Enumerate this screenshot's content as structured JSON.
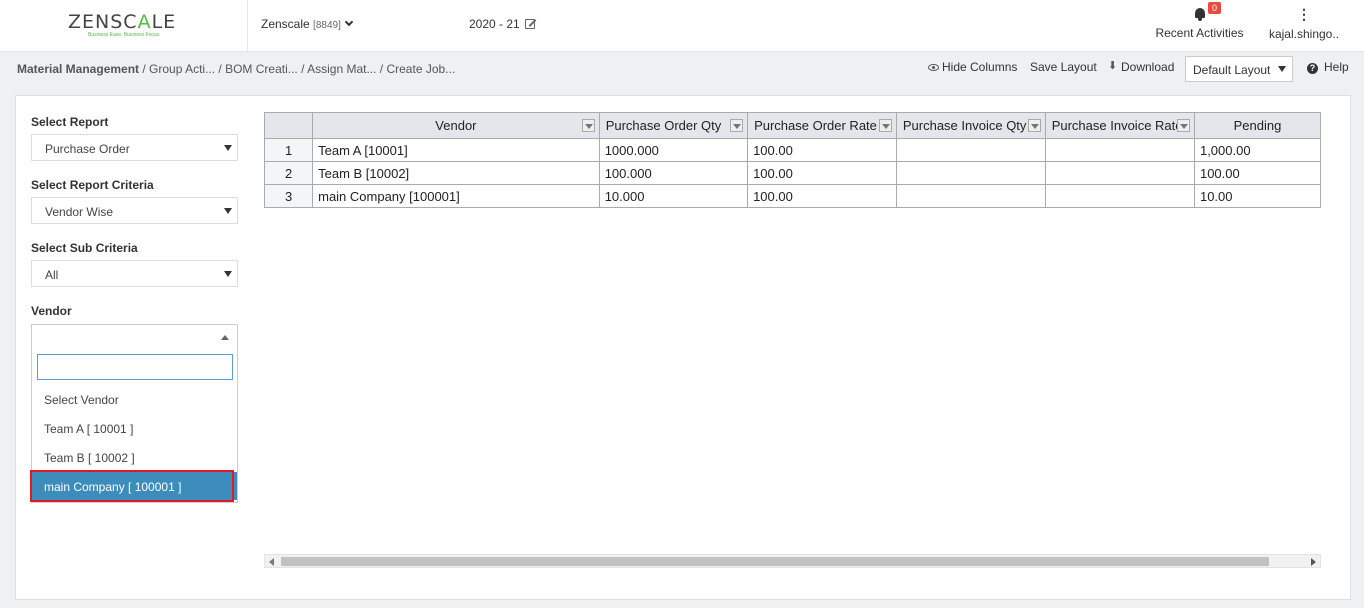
{
  "header": {
    "logo_main": "ZENSC",
    "logo_accent": "A",
    "logo_end": "LE",
    "logo_tagline": "Business Ease. Business Focus.",
    "company_name": "Zenscale",
    "company_code": "[8849]",
    "financial_year": "2020 - 21",
    "notification_count": "0",
    "recent_activities": "Recent Activities",
    "user_name": "kajal.shingo.."
  },
  "breadcrumb": {
    "items": [
      "Material Management",
      " / Group Acti...",
      " / BOM Creati...",
      " / Assign Mat...",
      " / Create Job..."
    ]
  },
  "toolbar": {
    "hide_columns": "Hide Columns",
    "save_layout": "Save Layout",
    "download": "Download",
    "layout_value": "Default Layout",
    "help": "Help"
  },
  "filters": {
    "report_label": "Select Report",
    "report_value": "Purchase Order",
    "criteria_label": "Select Report Criteria",
    "criteria_value": "Vendor Wise",
    "sub_label": "Select Sub Criteria",
    "sub_value": "All",
    "vendor_label": "Vendor",
    "vendor_options": [
      "Select Vendor",
      "Team A [ 10001 ]",
      "Team B [ 10002 ]",
      "main Company [ 100001 ]"
    ],
    "vendor_selected_index": 3
  },
  "grid": {
    "columns": [
      "",
      "Vendor",
      "Purchase Order Qty",
      "Purchase Order Rate",
      "Purchase Invoice Qty",
      "Purchase Invoice Rate",
      "Pending"
    ],
    "rows": [
      [
        "1",
        "Team A [10001]",
        "1000.000",
        "100.00",
        "",
        "",
        "1,000.00"
      ],
      [
        "2",
        "Team B [10002]",
        "100.000",
        "100.00",
        "",
        "",
        "100.00"
      ],
      [
        "3",
        "main Company [100001]",
        "10.000",
        "100.00",
        "",
        "",
        "10.00"
      ]
    ]
  },
  "colors": {
    "accent_green": "#57b847",
    "selected_blue": "#3c8dbc",
    "highlight_red": "#e01b24",
    "badge_red": "#e74c3c"
  }
}
